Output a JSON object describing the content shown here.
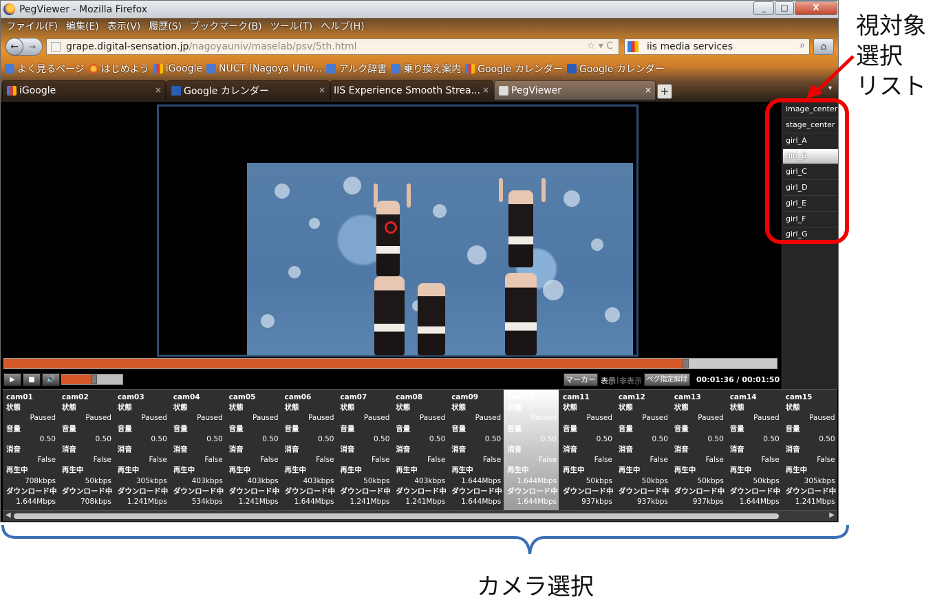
{
  "window": {
    "title": "PegViewer - Mozilla Firefox",
    "minimize_glyph": "_",
    "maximize_glyph": "□",
    "close_glyph": "X"
  },
  "menu": [
    "ファイル(F)",
    "編集(E)",
    "表示(V)",
    "履歴(S)",
    "ブックマーク(B)",
    "ツール(T)",
    "ヘルプ(H)"
  ],
  "nav": {
    "back_glyph": "←",
    "forward_glyph": "→",
    "url_domain": "grape.digital-sensation.jp",
    "url_path": "/nagoyauniv/maselab/psv/5th.html",
    "star_glyph": "☆ ▾ C",
    "search_value": "iis media services",
    "search_glyph": "⌕",
    "home_glyph": "⌂"
  },
  "bookmarks": [
    "よく見るページ",
    "はじめよう",
    "iGoogle",
    "NUCT (Nagoya Univ...",
    "アルク辞書",
    "乗り換え案内",
    "Google カレンダー",
    "Google カレンダー"
  ],
  "tabs": [
    "iGoogle",
    "Google カレンダー",
    "IIS Experience Smooth Strea...",
    "PegViewer"
  ],
  "tab_close_glyph": "×",
  "new_tab_glyph": "+",
  "tab_list_glyph": "▾",
  "player": {
    "play_glyph": "▶",
    "stop_glyph": "■",
    "volume_glyph": "🔊",
    "seek_progress": 0.878,
    "volume_level": 0.5,
    "marker_label": "マーカー",
    "show_label": "表示",
    "sep": "|",
    "hide_label": "非表示",
    "peg_label": "ペグ指定解除",
    "time": "00:01:36 / 00:01:50"
  },
  "targets": [
    "image_center",
    "stage_center",
    "girl_A",
    "girl_B",
    "girl_C",
    "girl_D",
    "girl_E",
    "girl_F",
    "girl_G"
  ],
  "selected_target": "girl_B",
  "cameras": [
    {
      "name": "cam01",
      "state_label": "状態",
      "state": "Paused",
      "vol_label": "音量",
      "volume": "0.50",
      "mute_label": "消音",
      "mute": "False",
      "play_label": "再生中",
      "play_rate": "708kbps",
      "dl_label": "ダウンロード中",
      "dl_rate": "1.644Mbps"
    },
    {
      "name": "cam02",
      "state_label": "状態",
      "state": "Paused",
      "vol_label": "音量",
      "volume": "0.50",
      "mute_label": "消音",
      "mute": "False",
      "play_label": "再生中",
      "play_rate": "50kbps",
      "dl_label": "ダウンロード中",
      "dl_rate": "708kbps"
    },
    {
      "name": "cam03",
      "state_label": "状態",
      "state": "Paused",
      "vol_label": "音量",
      "volume": "0.50",
      "mute_label": "消音",
      "mute": "False",
      "play_label": "再生中",
      "play_rate": "305kbps",
      "dl_label": "ダウンロード中",
      "dl_rate": "1.241Mbps"
    },
    {
      "name": "cam04",
      "state_label": "状態",
      "state": "Paused",
      "vol_label": "音量",
      "volume": "0.50",
      "mute_label": "消音",
      "mute": "False",
      "play_label": "再生中",
      "play_rate": "403kbps",
      "dl_label": "ダウンロード中",
      "dl_rate": "534kbps"
    },
    {
      "name": "cam05",
      "state_label": "状態",
      "state": "Paused",
      "vol_label": "音量",
      "volume": "0.50",
      "mute_label": "消音",
      "mute": "False",
      "play_label": "再生中",
      "play_rate": "403kbps",
      "dl_label": "ダウンロード中",
      "dl_rate": "1.241Mbps"
    },
    {
      "name": "cam06",
      "state_label": "状態",
      "state": "Paused",
      "vol_label": "音量",
      "volume": "0.50",
      "mute_label": "消音",
      "mute": "False",
      "play_label": "再生中",
      "play_rate": "403kbps",
      "dl_label": "ダウンロード中",
      "dl_rate": "1.644Mbps"
    },
    {
      "name": "cam07",
      "state_label": "状態",
      "state": "Paused",
      "vol_label": "音量",
      "volume": "0.50",
      "mute_label": "消音",
      "mute": "False",
      "play_label": "再生中",
      "play_rate": "50kbps",
      "dl_label": "ダウンロード中",
      "dl_rate": "1.241Mbps"
    },
    {
      "name": "cam08",
      "state_label": "状態",
      "state": "Paused",
      "vol_label": "音量",
      "volume": "0.50",
      "mute_label": "消音",
      "mute": "False",
      "play_label": "再生中",
      "play_rate": "403kbps",
      "dl_label": "ダウンロード中",
      "dl_rate": "1.241Mbps"
    },
    {
      "name": "cam09",
      "state_label": "状態",
      "state": "Paused",
      "vol_label": "音量",
      "volume": "0.50",
      "mute_label": "消音",
      "mute": "False",
      "play_label": "再生中",
      "play_rate": "1.644Mbps",
      "dl_label": "ダウンロード中",
      "dl_rate": "1.644Mbps"
    },
    {
      "name": "cam10",
      "state_label": "状態",
      "state": "Paused",
      "vol_label": "音量",
      "volume": "0.50",
      "mute_label": "消音",
      "mute": "False",
      "play_label": "再生中",
      "play_rate": "1.644Mbps",
      "dl_label": "ダウンロード中",
      "dl_rate": "1.644Mbps"
    },
    {
      "name": "cam11",
      "state_label": "状態",
      "state": "Paused",
      "vol_label": "音量",
      "volume": "0.50",
      "mute_label": "消音",
      "mute": "False",
      "play_label": "再生中",
      "play_rate": "50kbps",
      "dl_label": "ダウンロード中",
      "dl_rate": "937kbps"
    },
    {
      "name": "cam12",
      "state_label": "状態",
      "state": "Paused",
      "vol_label": "音量",
      "volume": "0.50",
      "mute_label": "消音",
      "mute": "False",
      "play_label": "再生中",
      "play_rate": "50kbps",
      "dl_label": "ダウンロード中",
      "dl_rate": "937kbps"
    },
    {
      "name": "cam13",
      "state_label": "状態",
      "state": "Paused",
      "vol_label": "音量",
      "volume": "0.50",
      "mute_label": "消音",
      "mute": "False",
      "play_label": "再生中",
      "play_rate": "50kbps",
      "dl_label": "ダウンロード中",
      "dl_rate": "937kbps"
    },
    {
      "name": "cam14",
      "state_label": "状態",
      "state": "Paused",
      "vol_label": "音量",
      "volume": "0.50",
      "mute_label": "消音",
      "mute": "False",
      "play_label": "再生中",
      "play_rate": "50kbps",
      "dl_label": "ダウンロード中",
      "dl_rate": "1.644Mbps"
    },
    {
      "name": "cam15",
      "state_label": "状態",
      "state": "Paused",
      "vol_label": "音量",
      "volume": "0.50",
      "mute_label": "消音",
      "mute": "False",
      "play_label": "再生中",
      "play_rate": "305kbps",
      "dl_label": "ダウンロード中",
      "dl_rate": "1.241Mbps"
    }
  ],
  "selected_camera": "cam10",
  "scroll": {
    "left_glyph": "◀",
    "right_glyph": "▶"
  },
  "annotations": {
    "target_list": [
      "視対象",
      "選択",
      "リスト"
    ],
    "camera_select": "カメラ選択",
    "highlight_color": "#ef0000",
    "bracket_color": "#3a6fb5"
  },
  "colors": {
    "accent": "#d4582a",
    "panel": "#2f2f2f"
  }
}
